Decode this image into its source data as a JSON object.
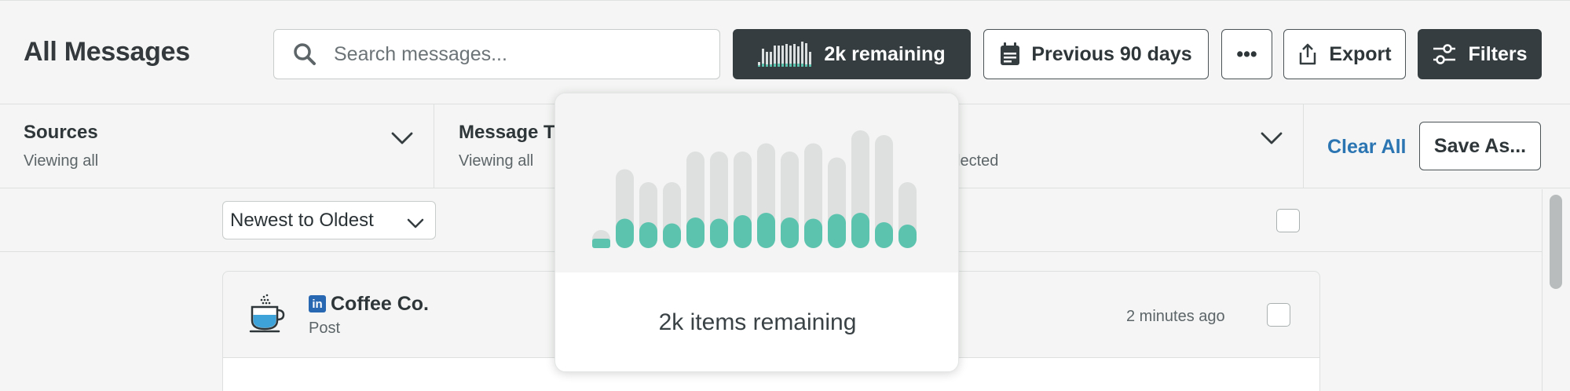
{
  "header": {
    "title": "All Messages",
    "search": {
      "placeholder": "Search messages...",
      "value": ""
    },
    "remaining_button": "2k remaining",
    "date_range_button": "Previous 90 days",
    "more_button": "•••",
    "export_button": "Export",
    "filters_button": "Filters"
  },
  "filters": {
    "sources": {
      "title": "Sources",
      "subtitle": "Viewing all"
    },
    "message_types": {
      "title": "Message T",
      "subtitle": "Viewing all"
    },
    "third": {
      "subtitle": "lected"
    },
    "clear_all": "Clear All",
    "save_as": "Save As..."
  },
  "list": {
    "sort": {
      "selected": "Newest to Oldest"
    }
  },
  "message": {
    "author": "Coffee Co.",
    "network_badge": "in",
    "post_type": "Post",
    "time": "2 minutes ago"
  },
  "usage_popover": {
    "text": "2k items remaining",
    "bars": {
      "total": [
        0.13,
        0.67,
        0.56,
        0.56,
        0.82,
        0.82,
        0.82,
        0.89,
        0.82,
        0.89,
        0.77,
        1.0,
        0.96,
        0.56
      ],
      "used": [
        0.06,
        0.25,
        0.22,
        0.21,
        0.26,
        0.25,
        0.28,
        0.3,
        0.26,
        0.25,
        0.29,
        0.3,
        0.22,
        0.2
      ]
    }
  },
  "colors": {
    "accent_teal": "#5cc4ae",
    "bar_track": "#dedfdf",
    "dark_button": "#353d40",
    "link_blue": "#2b75b3",
    "linkedin_blue": "#2867b2"
  }
}
